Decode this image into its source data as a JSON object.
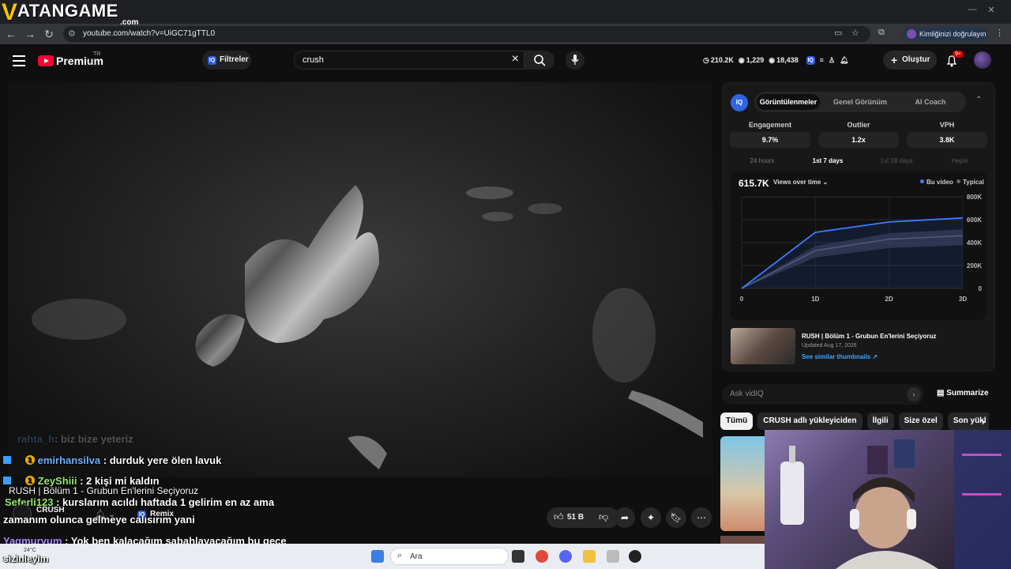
{
  "overlay": {
    "logo_main": "ATANGAME",
    "logo_sub": ".com"
  },
  "browser": {
    "url": "youtube.com/watch?v=UiGC71gTTL0",
    "verify_label": "Kimliğinizi doğrulayın"
  },
  "header": {
    "brand": "Premium",
    "region": "TR",
    "filters_label": "Filtreler",
    "search_value": "crush",
    "stats": {
      "views": "210.2K",
      "eye": "1,229",
      "watchers": "18,438"
    },
    "create_label": "Oluştur",
    "notif_count": "9+"
  },
  "chat": [
    {
      "user": "emirhansilva",
      "msg": ": durduk yere ölen lavuk",
      "badge": "1"
    },
    {
      "user": "ZeyShiii",
      "msg": ": 2 kişi mi kaldın",
      "badge": "1"
    },
    {
      "user": "Seferli123",
      "msg": ": kurslarım acıldı haftada 1 gelirim en az ama"
    },
    {
      "user": "",
      "msg": "zamanım olunca gelmeye calısırım yani"
    },
    {
      "user": "Yagmuryum",
      "msg": ": Yok ben kalacağım sabahlayacağım bu gece"
    },
    {
      "user": "",
      "msg": "sizinleyim"
    }
  ],
  "faded_chat": {
    "user": "rahta_h",
    "msg": ": biz bize yeteriz"
  },
  "video": {
    "title_overlay": "RUSH | Bölüm 1 - Grubun En'lerini Seçiyoruz",
    "channel": "CRUSH",
    "remix_label": "Remix",
    "likes": "51 B"
  },
  "vidiq": {
    "tabs": [
      "Görüntülenmeler",
      "Genel Görünüm",
      "AI Coach"
    ],
    "metrics": [
      {
        "label": "Engagement",
        "value": "9.7%"
      },
      {
        "label": "Outlier",
        "value": "1.2x"
      },
      {
        "label": "VPH",
        "value": "3.8K"
      }
    ],
    "ranges": [
      "24 hours",
      "1st 7 days",
      "1st 28 days",
      "Hepsi"
    ],
    "chart_value": "615.7K",
    "chart_mode": "Views over time",
    "legend": [
      "Bu video",
      "Typical"
    ],
    "similar": {
      "title": "RUSH | Bölüm 1 - Grubun En'lerini Seçiyoruz",
      "date": "Updated Aug 17, 2026",
      "link": "See similar thumbnails ↗"
    },
    "ask_placeholder": "Ask vidIQ",
    "summarize_label": "Summarize"
  },
  "chips": [
    "Tümü",
    "CRUSH adlı yükleyiciden",
    "İlgili",
    "Size özel",
    "Son yükl"
  ],
  "taskbar": {
    "search_label": "Ara",
    "weather": "24°C"
  },
  "chart_data": {
    "type": "line",
    "x": [
      "0",
      "1D",
      "2D",
      "3D"
    ],
    "series": [
      {
        "name": "Bu video",
        "values": [
          0,
          490000,
          580000,
          615700
        ]
      },
      {
        "name": "Typical",
        "values": [
          0,
          330000,
          430000,
          460000
        ]
      }
    ],
    "yticks": [
      "0",
      "200K",
      "400K",
      "600K",
      "800K"
    ],
    "ylim": [
      0,
      800000
    ]
  }
}
